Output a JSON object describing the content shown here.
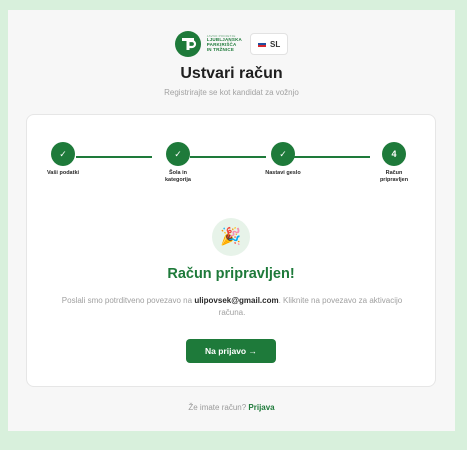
{
  "brand": {
    "logo_lines": [
      "LJUBLJANSKA",
      "PARKIRIŠČA",
      "IN TRŽNICE"
    ],
    "primary_color": "#1e7a3a"
  },
  "language": {
    "code": "SL"
  },
  "header": {
    "title": "Ustvari račun",
    "subtitle": "Registrirajte se kot kandidat za vožnjo"
  },
  "stepper": {
    "steps": [
      {
        "label": "Vaši podatki",
        "state": "done"
      },
      {
        "label": "Šola in kategorija",
        "state": "done"
      },
      {
        "label": "Nastavi geslo",
        "state": "done"
      },
      {
        "label": "Račun pripravljen",
        "state": "current",
        "number": "4"
      }
    ]
  },
  "success": {
    "icon": "party-popper-icon",
    "title": "Račun pripravljen!",
    "msg_before": "Poslali smo potrditveno povezavo na ",
    "email": "ulipovsek@gmail.com",
    "msg_after": ". Kliknite na povezavo za aktivacijo računa.",
    "button_label": "Na prijavo →"
  },
  "footer": {
    "question": "Že imate račun? ",
    "link": "Prijava"
  }
}
